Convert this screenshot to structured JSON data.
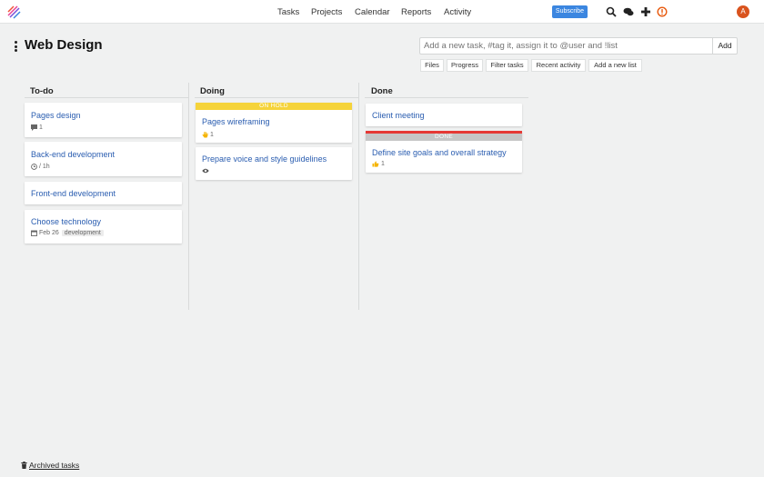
{
  "nav": {
    "items": [
      "Tasks",
      "Projects",
      "Calendar",
      "Reports",
      "Activity"
    ],
    "subscribe_label": "Subscribe",
    "avatar_initial": "A"
  },
  "project": {
    "title": "Web Design"
  },
  "add_task": {
    "placeholder": "Add a new task, #tag it, assign it to @user and !list",
    "add_label": "Add",
    "buttons": [
      "Files",
      "Progress",
      "Filter tasks",
      "Recent activity",
      "Add a new list"
    ]
  },
  "lists": [
    {
      "title": "To-do",
      "cards": [
        {
          "title": "Pages design",
          "meta": "1",
          "meta_icon": "comment-icon"
        },
        {
          "title": "Back-end development",
          "meta": "/ 1h",
          "meta_icon": "clock-icon"
        },
        {
          "title": "Front-end development"
        },
        {
          "title": "Choose technology",
          "meta": "Feb 26",
          "meta_icon": "calendar-icon",
          "tag": "development"
        }
      ]
    },
    {
      "title": "Doing",
      "cards": [
        {
          "title": "Pages wireframing",
          "banner": "ON HOLD",
          "banner_color": "#f5d33a",
          "meta": "1",
          "meta_icon": "hand-icon"
        },
        {
          "title": "Prepare voice and style guidelines",
          "meta_icon": "eye-icon"
        }
      ]
    },
    {
      "title": "Done",
      "cards": [
        {
          "title": "Client meeting"
        },
        {
          "title": "Define site goals and overall strategy",
          "banner": "DONE",
          "banner_color": "#c6c6c6",
          "stripe_color": "#e53935",
          "meta": "1",
          "meta_icon": "thumbs-up-icon"
        }
      ]
    }
  ],
  "footer": {
    "archived_label": "Archived tasks"
  }
}
